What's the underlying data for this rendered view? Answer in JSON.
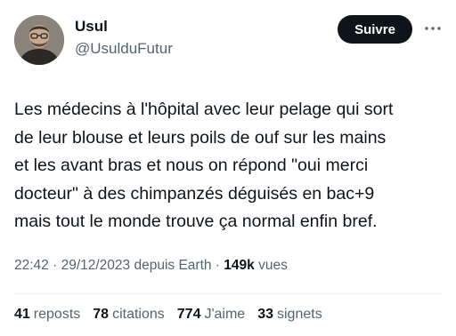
{
  "author": {
    "display_name": "Usul",
    "handle": "@UsulduFutur"
  },
  "follow_button": {
    "label": "Suivre"
  },
  "tweet": {
    "lines": [
      "Les médecins à l'hôpital avec leur pelage qui sort",
      "de leur blouse et leurs poils de ouf sur les mains",
      "et les avant bras et nous on répond \"oui merci",
      "docteur\" à des chimpanzés déguisés en bac+9",
      "mais tout le monde trouve ça normal enfin bref."
    ]
  },
  "meta": {
    "time": "22:42",
    "separator1": " · ",
    "date": "29/12/2023",
    "source": " depuis Earth",
    "separator2": " · ",
    "views_count": "149k",
    "views_label": " vues"
  },
  "stats": {
    "reposts": {
      "count": "41",
      "label": "reposts"
    },
    "citations": {
      "count": "78",
      "label": "citations"
    },
    "likes": {
      "count": "774",
      "label": "J'aime"
    },
    "bookmarks": {
      "count": "33",
      "label": "signets"
    }
  },
  "icons": {
    "more": "more-horizontal-icon",
    "avatar": "avatar"
  },
  "colors": {
    "text_primary": "#0f1419",
    "text_secondary": "#536471",
    "button_bg": "#0f1419",
    "divider": "#eff3f4"
  }
}
